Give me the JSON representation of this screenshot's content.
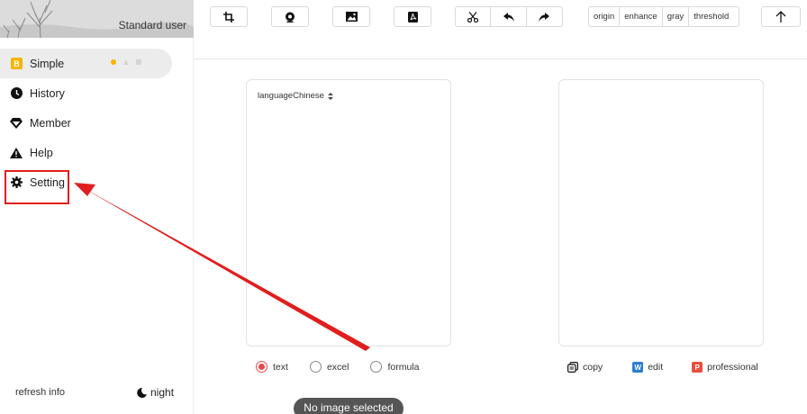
{
  "sidebar": {
    "user_label": "Standard user",
    "items": [
      {
        "label": "Simple",
        "icon": "simple-icon",
        "active": true
      },
      {
        "label": "History",
        "icon": "clock-icon"
      },
      {
        "label": "Member",
        "icon": "diamond-icon"
      },
      {
        "label": "Help",
        "icon": "warning-icon"
      },
      {
        "label": "Setting",
        "icon": "gear-icon"
      }
    ],
    "refresh_label": "refresh info",
    "night_label": "night"
  },
  "toolbar": {
    "icons": [
      "crop-icon",
      "camera-icon",
      "image-icon",
      "pdf-icon"
    ],
    "edit_group": [
      "cut-icon",
      "undo-icon",
      "redo-icon"
    ],
    "filters": [
      "origin",
      "enhance",
      "gray",
      "threshold"
    ],
    "upload_icon": "upload-arrow-icon"
  },
  "left_panel": {
    "language_label": "language",
    "language_value": "Chinese"
  },
  "modes": [
    {
      "label": "text",
      "selected": true
    },
    {
      "label": "excel",
      "selected": false
    },
    {
      "label": "formula",
      "selected": false
    }
  ],
  "actions": {
    "copy": "copy",
    "edit": "edit",
    "professional": "professional",
    "edit_badge": "W",
    "professional_badge": "P"
  },
  "status": "No image selected",
  "colors": {
    "accent_red": "#e84b4b",
    "annotation_red": "#e01e1e",
    "dot_yellow": "#f5b400",
    "word_blue": "#2b7cd3",
    "ppt_red": "#e8503a"
  }
}
